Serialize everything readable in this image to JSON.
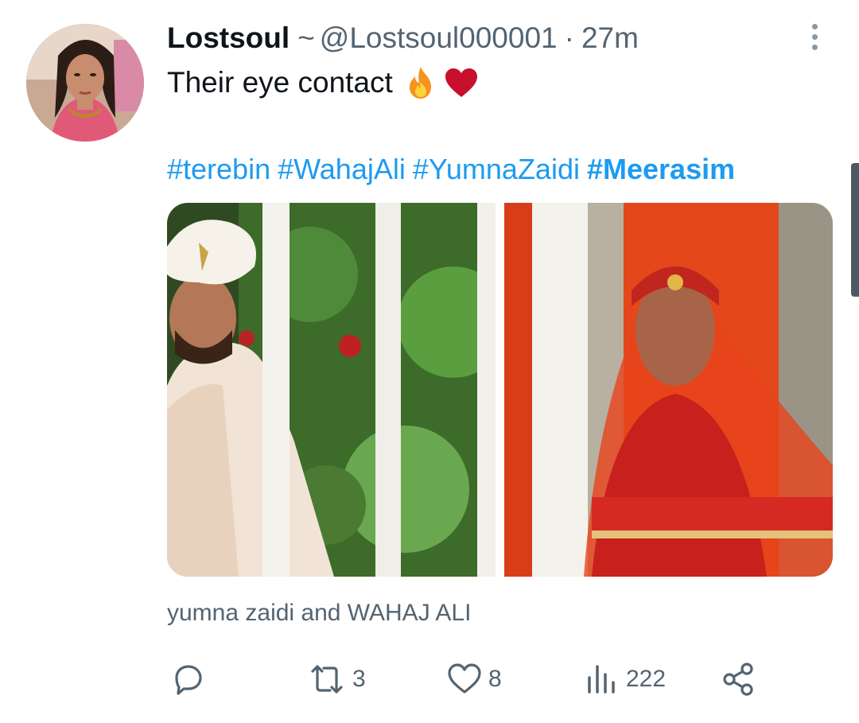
{
  "tweet": {
    "display_name": "Lostsoul",
    "separator": "~",
    "handle": "@Lostsoul000001",
    "dot": "·",
    "time": "27m",
    "text": "Their eye contact",
    "emoji": [
      "fire-emoji",
      "red-heart-emoji"
    ],
    "hashtags": [
      "#terebin",
      "#WahajAli",
      "#YumnaZaidi",
      "#Meerasim"
    ],
    "alt_text": "yumna zaidi and WAHAJ ALI"
  },
  "actions": {
    "reply": {
      "icon": "reply-icon",
      "count": ""
    },
    "retweet": {
      "icon": "retweet-icon",
      "count": "3"
    },
    "like": {
      "icon": "heart-icon",
      "count": "8"
    },
    "views": {
      "icon": "views-icon",
      "count": "222"
    },
    "share": {
      "icon": "share-icon"
    }
  },
  "colors": {
    "link": "#1d9bf0",
    "secondary_text": "#536471",
    "primary_text": "#0f1419"
  }
}
